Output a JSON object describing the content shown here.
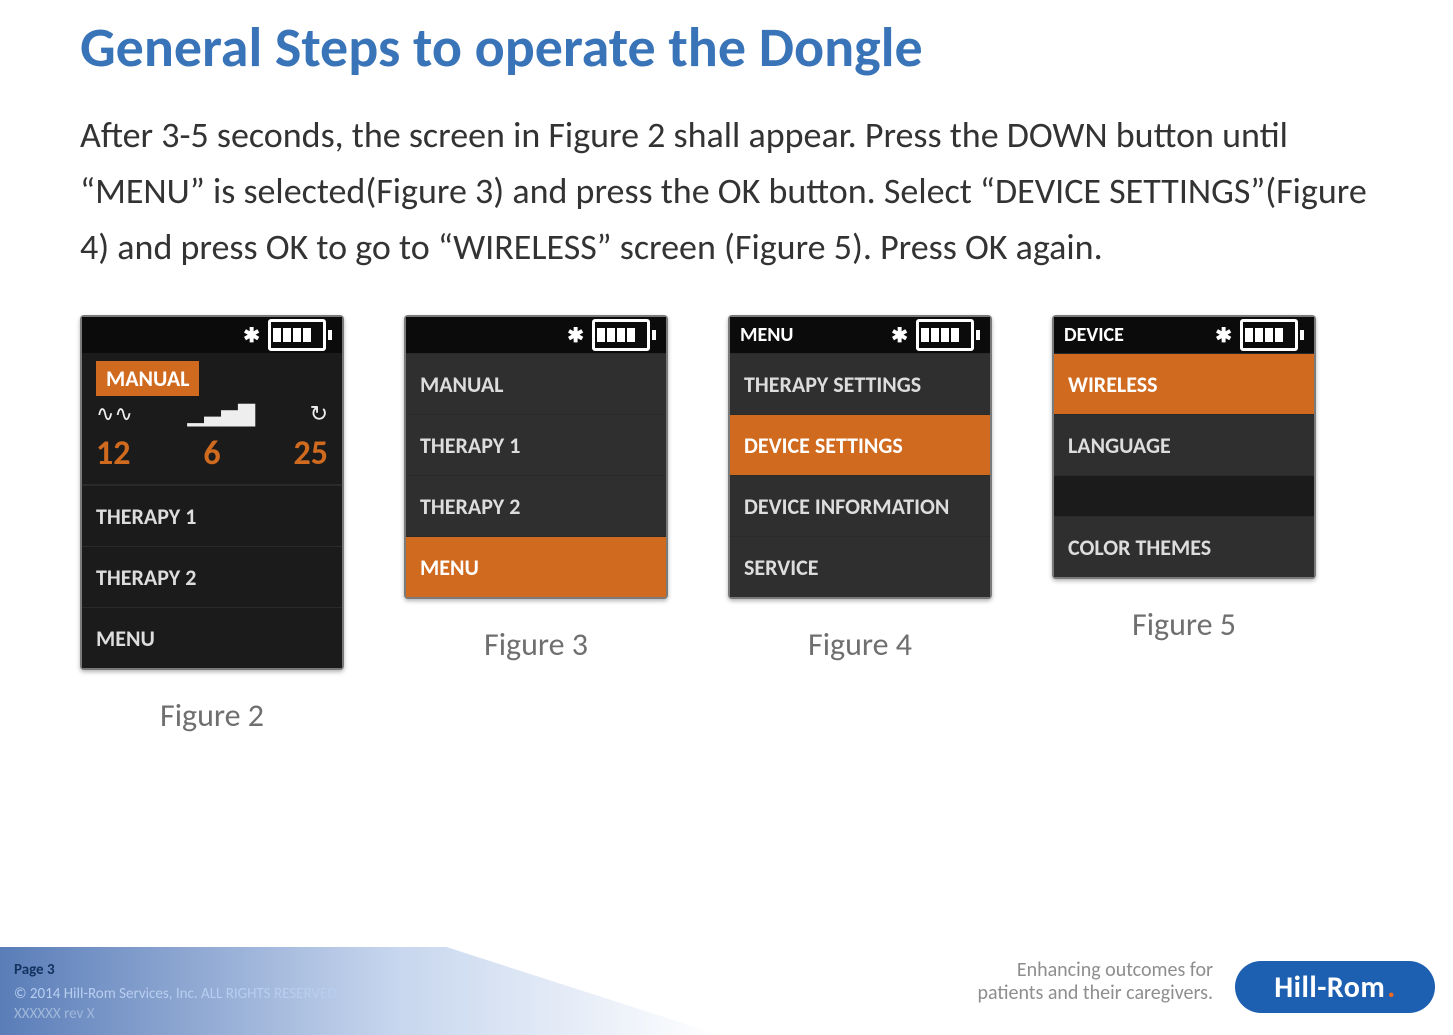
{
  "title": "General Steps to operate the Dongle",
  "body": "After 3-5 seconds, the screen in Figure 2 shall appear. Press the DOWN button until “MENU” is selected(Figure 3) and press the OK button. Select “DEVICE SETTINGS”(Figure 4) and press OK to go to “WIRELESS” screen (Figure 5). Press OK again.",
  "figures": {
    "f2": {
      "caption": "Figure 2",
      "statusbar_title": "",
      "manual_label": "MANUAL",
      "vals": {
        "a": "12",
        "b": "6",
        "c": "25"
      },
      "items": [
        "THERAPY 1",
        "THERAPY 2",
        "MENU"
      ]
    },
    "f3": {
      "caption": "Figure 3",
      "statusbar_title": "",
      "items": [
        "MANUAL",
        "THERAPY 1",
        "THERAPY 2",
        "MENU"
      ],
      "selected": "MENU"
    },
    "f4": {
      "caption": "Figure 4",
      "statusbar_title": "MENU",
      "items": [
        "THERAPY SETTINGS",
        "DEVICE SETTINGS",
        "DEVICE INFORMATION",
        "SERVICE"
      ],
      "selected": "DEVICE SETTINGS"
    },
    "f5": {
      "caption": "Figure 5",
      "statusbar_title": "DEVICE",
      "items": [
        "WIRELESS",
        "LANGUAGE",
        "COLOR THEMES"
      ],
      "selected": "WIRELESS"
    }
  },
  "footer": {
    "page": "Page 3",
    "copyright": "© 2014 Hill-Rom Services, Inc. ALL RIGHTS RESERVED",
    "rev": "XXXXXX  rev X",
    "tagline1": "Enhancing outcomes for",
    "tagline2": "patients and their caregivers.",
    "logo": "Hill-Rom"
  }
}
